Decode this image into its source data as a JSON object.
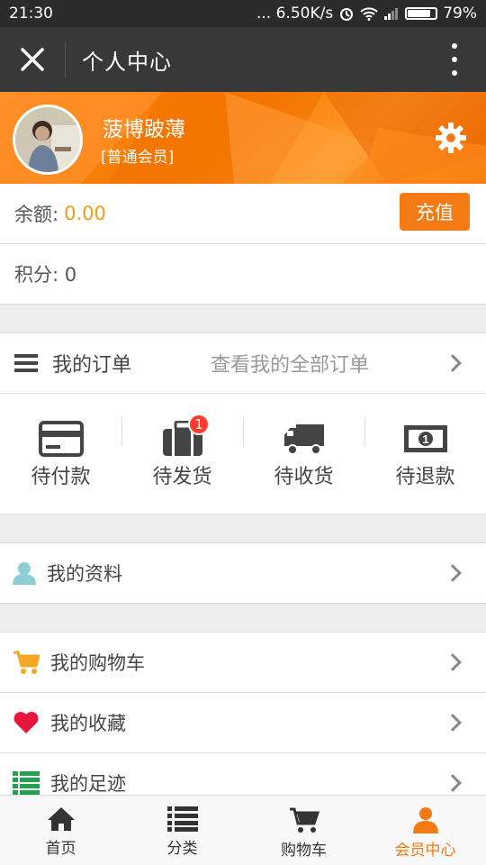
{
  "status_bar": {
    "time": "21:30",
    "speed": "... 6.50K/s",
    "battery": "79%"
  },
  "title_bar": {
    "title": "个人中心"
  },
  "profile": {
    "username": "菠博跛薄",
    "member_level": "[普通会员]"
  },
  "account": {
    "balance_label": "余额:",
    "balance_value": "0.00",
    "recharge_label": "充值",
    "points_label": "积分: 0"
  },
  "orders": {
    "title": "我的订单",
    "view_all": "查看我的全部订单",
    "statuses": [
      {
        "label": "待付款",
        "icon": "card-icon"
      },
      {
        "label": "待发货",
        "icon": "suitcase-icon",
        "badge": "1"
      },
      {
        "label": "待收货",
        "icon": "truck-icon"
      },
      {
        "label": "待退款",
        "icon": "banknote-icon"
      }
    ]
  },
  "menu": {
    "profile": "我的资料",
    "cart": "我的购物车",
    "favorites": "我的收藏",
    "footprints": "我的足迹"
  },
  "tabs": [
    {
      "label": "首页",
      "icon": "home-icon"
    },
    {
      "label": "分类",
      "icon": "list-icon"
    },
    {
      "label": "购物车",
      "icon": "cart-icon"
    },
    {
      "label": "会员中心",
      "icon": "user-icon"
    }
  ],
  "colors": {
    "accent": "#f47a14",
    "balance": "#f39c12",
    "badge": "#ff3b2f",
    "heart": "#e8163c",
    "footprint": "#22a04b",
    "profile_icon": "#8ccdd8"
  }
}
